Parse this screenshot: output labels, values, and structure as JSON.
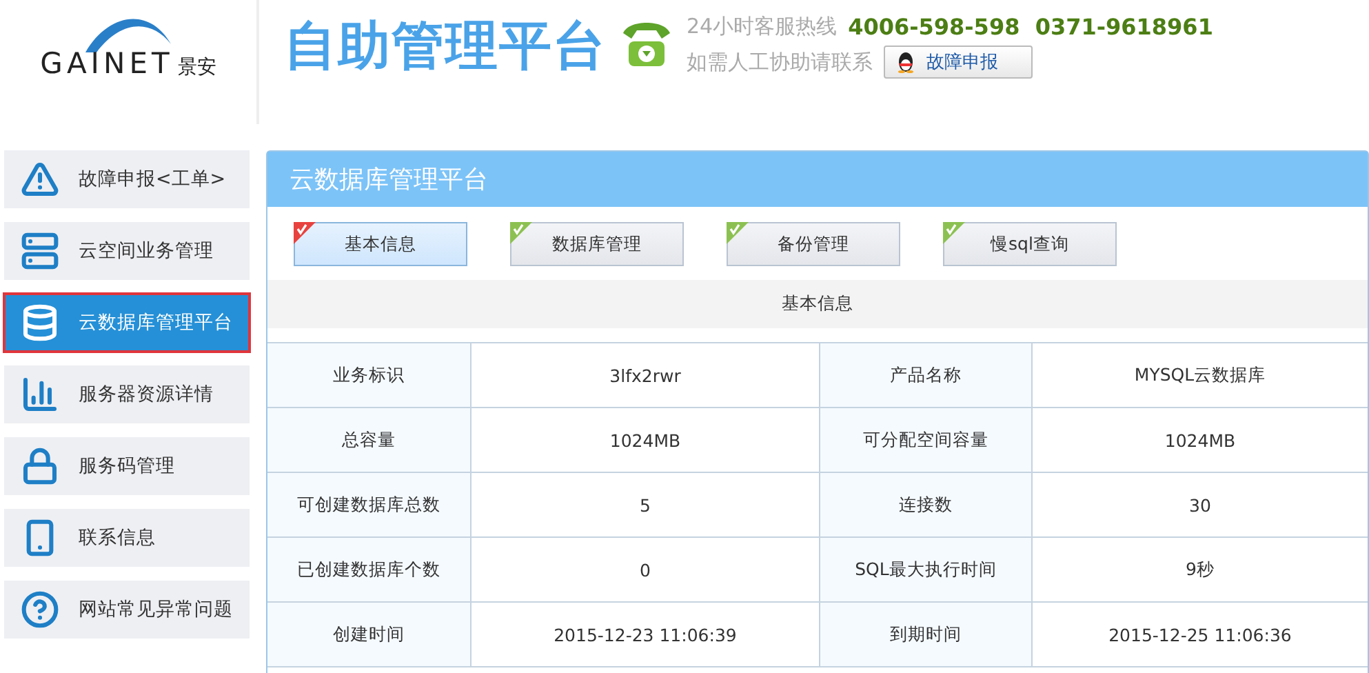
{
  "logo": {
    "text": "GAINET",
    "subtext": "景安"
  },
  "header": {
    "title": "自助管理平台",
    "hotline_label": "24小时客服热线",
    "hotline_numbers": "4006-598-598  0371-9618961",
    "contact_label": "如需人工协助请联系",
    "report_button": "故障申报"
  },
  "sidebar": {
    "items": [
      {
        "kind": "warning",
        "label": "故障申报<工单>",
        "selected": false
      },
      {
        "kind": "server",
        "label": "云空间业务管理",
        "selected": false
      },
      {
        "kind": "database",
        "label": "云数据库管理平台",
        "selected": true
      },
      {
        "kind": "chart",
        "label": "服务器资源详情",
        "selected": false
      },
      {
        "kind": "lock",
        "label": "服务码管理",
        "selected": false
      },
      {
        "kind": "phone",
        "label": "联系信息",
        "selected": false
      },
      {
        "kind": "help",
        "label": "网站常见异常问题",
        "selected": false
      }
    ]
  },
  "panel": {
    "title": "云数据库管理平台",
    "tabs": [
      {
        "label": "基本信息",
        "selected": true
      },
      {
        "label": "数据库管理",
        "selected": false
      },
      {
        "label": "备份管理",
        "selected": false
      },
      {
        "label": "慢sql查询",
        "selected": false
      }
    ],
    "section_title": "基本信息",
    "rows": [
      [
        "业务标识",
        "3lfx2rwr",
        "产品名称",
        "MYSQL云数据库"
      ],
      [
        "总容量",
        "1024MB",
        "可分配空间容量",
        "1024MB"
      ],
      [
        "可创建数据库总数",
        "5",
        "连接数",
        "30"
      ],
      [
        "已创建数据库个数",
        "0",
        "SQL最大执行时间",
        "9秒"
      ],
      [
        "创建时间",
        "2015-12-23 11:06:39",
        "到期时间",
        "2015-12-25 11:06:36"
      ]
    ]
  }
}
